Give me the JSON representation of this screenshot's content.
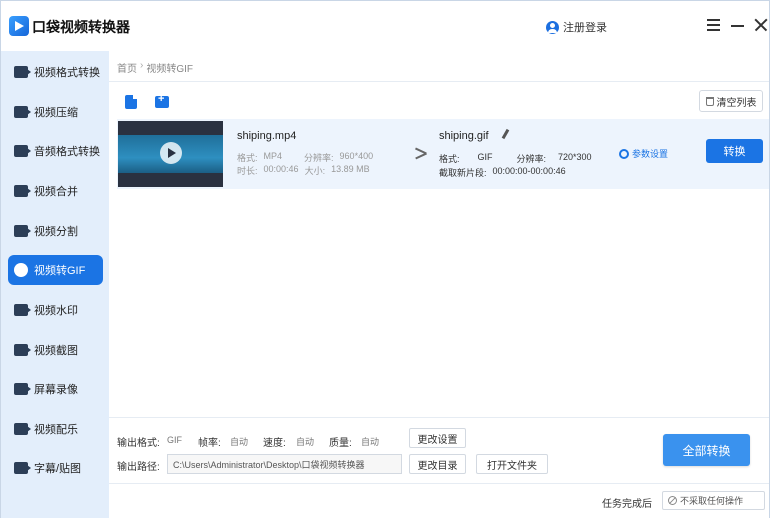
{
  "app": {
    "title": "口袋视频转换器",
    "login_label": "注册登录"
  },
  "sidebar": {
    "items": [
      {
        "label": "视频格式转换",
        "icon": "video-convert-icon"
      },
      {
        "label": "视频压缩",
        "icon": "video-compress-icon"
      },
      {
        "label": "音频格式转换",
        "icon": "audio-convert-icon"
      },
      {
        "label": "视频合并",
        "icon": "video-merge-icon"
      },
      {
        "label": "视频分割",
        "icon": "video-split-icon"
      },
      {
        "label": "视频转GIF",
        "icon": "gif-icon",
        "active": true
      },
      {
        "label": "视频水印",
        "icon": "watermark-icon"
      },
      {
        "label": "视频截图",
        "icon": "screenshot-icon"
      },
      {
        "label": "屏幕录像",
        "icon": "screen-record-icon"
      },
      {
        "label": "视频配乐",
        "icon": "music-icon"
      },
      {
        "label": "字幕/贴图",
        "icon": "subtitle-icon"
      }
    ]
  },
  "breadcrumb": {
    "home": "首页",
    "separator": "›",
    "current": "视频转GIF"
  },
  "toolbar": {
    "clear_label": "清空列表"
  },
  "file": {
    "source_name": "shiping.mp4",
    "format_label": "格式:",
    "format_value": "MP4",
    "res_label": "分辨率:",
    "res_value": "960*400",
    "duration_label": "时长:",
    "duration_value": "00:00:46",
    "size_label": "大小:",
    "size_value": "13.89 MB",
    "target_name": "shiping.gif",
    "target_format_value": "GIF",
    "target_res_value": "720*300",
    "clip_label": "截取新片段:",
    "clip_value": "00:00:00-00:00:46",
    "settings_label": "参数设置",
    "convert_label": "转换"
  },
  "output": {
    "format_label": "输出格式:",
    "format_value": "GIF",
    "fps_label": "帧率:",
    "fps_value": "自动",
    "speed_label": "速度:",
    "speed_value": "自动",
    "quality_label": "质量:",
    "quality_value": "自动",
    "change_settings_label": "更改设置",
    "path_label": "输出路径:",
    "path_value": "C:\\Users\\Administrator\\Desktop\\口袋视频转换器",
    "change_dir_label": "更改目录",
    "open_folder_label": "打开文件夹",
    "convert_all_label": "全部转换"
  },
  "footer": {
    "after_label": "任务完成后",
    "after_value": "不采取任何操作"
  },
  "colors": {
    "accent": "#1b74e4",
    "sidebar_bg": "#e3eefb",
    "row_bg": "#edf4fd"
  }
}
